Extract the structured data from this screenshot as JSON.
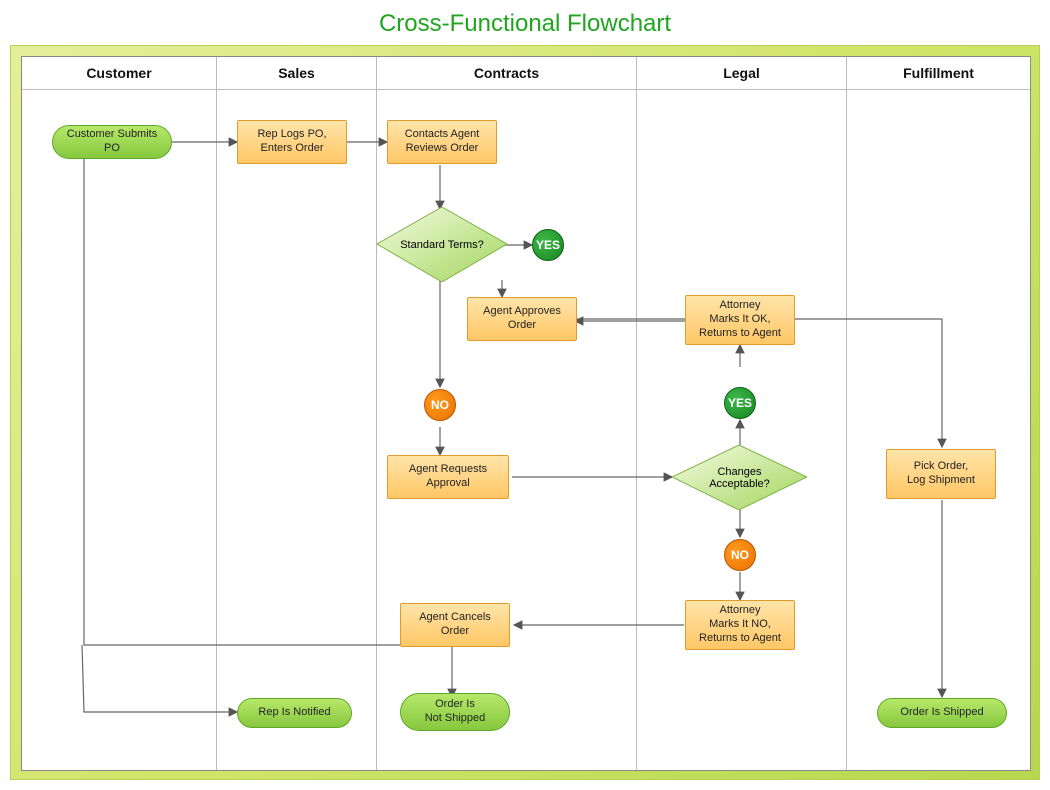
{
  "title": "Cross-Functional Flowchart",
  "lanes": {
    "customer": "Customer",
    "sales": "Sales",
    "contracts": "Contracts",
    "legal": "Legal",
    "fulfillment": "Fulfillment"
  },
  "nodes": {
    "customer_submits": "Customer Submits\nPO",
    "rep_logs": "Rep Logs PO,\nEnters Order",
    "contacts_agent": "Contacts Agent\nReviews Order",
    "standard_terms": "Standard Terms?",
    "agent_approves": "Agent Approves\nOrder",
    "agent_requests": "Agent Requests\nApproval",
    "agent_cancels": "Agent Cancels\nOrder",
    "attorney_ok": "Attorney\nMarks It OK,\nReturns to Agent",
    "attorney_no": "Attorney\nMarks It NO,\nReturns to Agent",
    "changes_acceptable": "Changes\nAcceptable?",
    "pick_order": "Pick Order,\nLog Shipment",
    "rep_notified": "Rep Is Notified",
    "order_not_shipped": "Order Is\nNot Shipped",
    "order_shipped": "Order Is Shipped"
  },
  "markers": {
    "yes": "YES",
    "no": "NO"
  }
}
